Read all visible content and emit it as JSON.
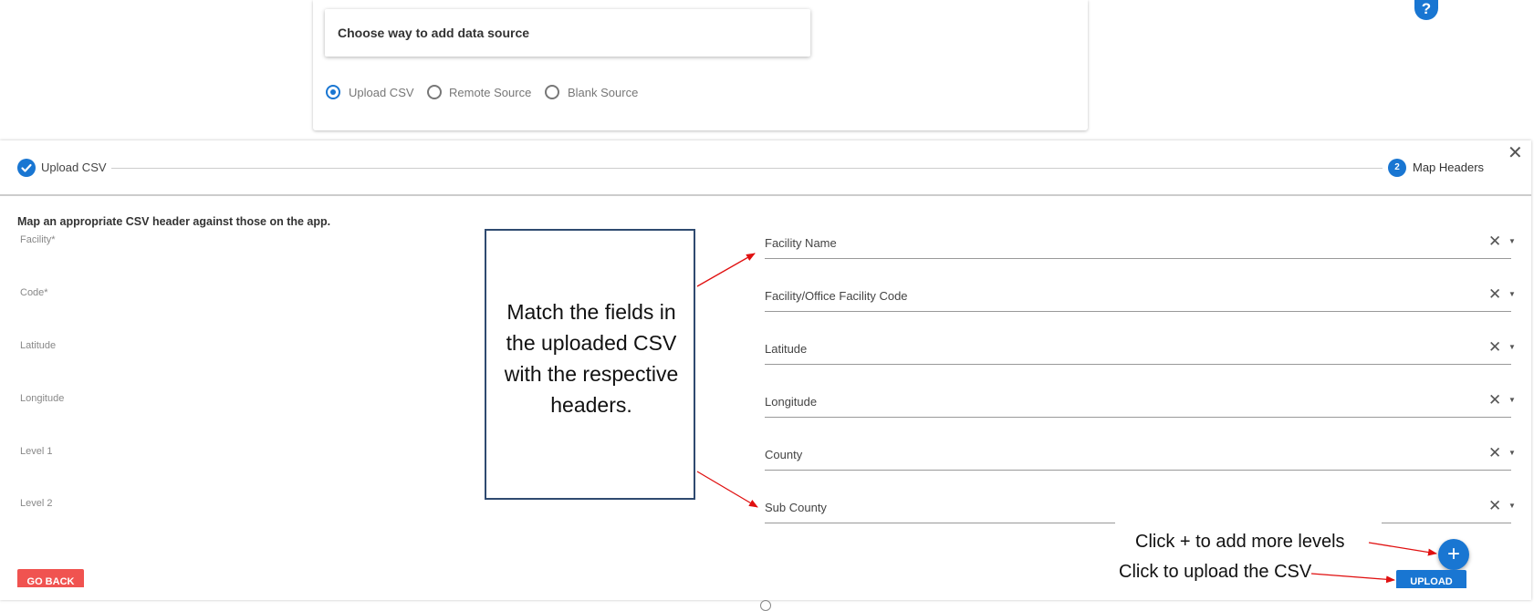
{
  "source_card": {
    "title": "Choose way to add data source",
    "options": [
      {
        "label": "Upload CSV",
        "selected": true
      },
      {
        "label": "Remote Source",
        "selected": false
      },
      {
        "label": "Blank Source",
        "selected": false
      }
    ]
  },
  "help": {
    "label": "?"
  },
  "dialog": {
    "close_label": "✕",
    "stepper": {
      "step1": {
        "label": "Upload CSV",
        "status": "completed",
        "icon": "check-icon"
      },
      "step2": {
        "number": "2",
        "label": "Map Headers",
        "status": "active"
      }
    },
    "instructions": "Map an appropriate CSV header against those on the app.",
    "mappings": [
      {
        "app_label": "Facility*",
        "csv_header": "Facility Name"
      },
      {
        "app_label": "Code*",
        "csv_header": "Facility/Office Facility Code"
      },
      {
        "app_label": "Latitude",
        "csv_header": "Latitude"
      },
      {
        "app_label": "Longitude",
        "csv_header": "Longitude"
      },
      {
        "app_label": "Level 1",
        "csv_header": "County"
      },
      {
        "app_label": "Level 2",
        "csv_header": "Sub County"
      }
    ],
    "clear_icon": "✕",
    "add_level_label": "+",
    "upload_label": "UPLOAD",
    "go_back_label": "GO BACK"
  },
  "annotations": {
    "callout": "Match the fields in the uploaded CSV with the respective headers.",
    "add_levels_note": "Click + to add more levels",
    "upload_note": "Click to upload the CSV",
    "arrow_color": "#e01010"
  },
  "colors": {
    "primary": "#1976d2",
    "danger": "#f05350"
  }
}
